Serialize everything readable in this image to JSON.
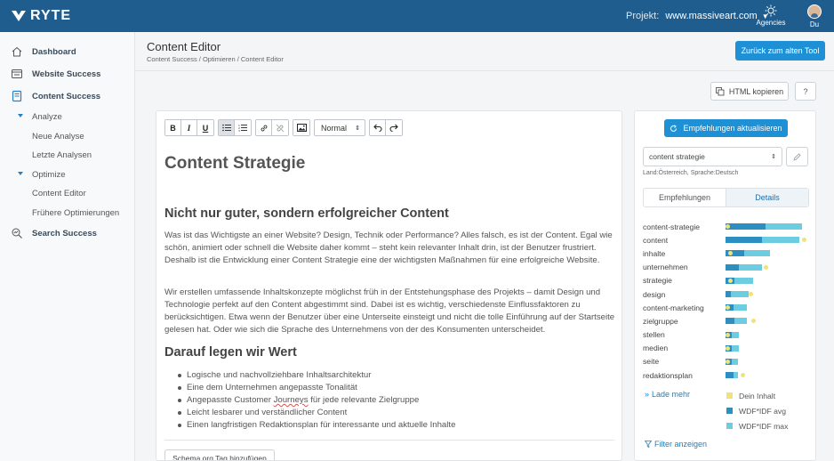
{
  "brand": {
    "name": "RYTE"
  },
  "topbar": {
    "project_label": "Projekt:",
    "project_value": "www.massiveart.com",
    "agencies_label": "Agencies",
    "user_label": "Du"
  },
  "sidebar": {
    "items": [
      {
        "label": "Dashboard",
        "icon": "home-icon"
      },
      {
        "label": "Website Success",
        "icon": "browser-icon"
      },
      {
        "label": "Content Success",
        "icon": "document-icon"
      },
      {
        "label": "Analyze"
      },
      {
        "label": "Neue Analyse"
      },
      {
        "label": "Letzte Analysen"
      },
      {
        "label": "Optimize"
      },
      {
        "label": "Content Editor"
      },
      {
        "label": "Frühere Optimierungen"
      },
      {
        "label": "Search Success",
        "icon": "search-chart-icon"
      }
    ]
  },
  "header": {
    "title": "Content Editor",
    "breadcrumb": "Content Success / Optimieren / Content Editor",
    "old_tool_button": "Zurück zum alten Tool",
    "html_copy_button": "HTML kopieren",
    "help_button": "?"
  },
  "editor": {
    "toolbar": {
      "bold": "B",
      "italic": "I",
      "underline": "U",
      "format_select": "Normal"
    },
    "h1": "Content Strategie",
    "h2_first": "Nicht nur guter, sondern erfolgreicher Content",
    "p1": "Was ist das Wichtigste an einer Website? Design, Technik oder Performance? Alles falsch, es ist der Content. Egal wie schön, animiert oder schnell die Website daher kommt – steht kein relevanter Inhalt drin, ist der Benutzer frustriert. Deshalb ist die Entwicklung einer Content Strategie eine der wichtigsten Maßnahmen für eine erfolgreiche Website.",
    "p2": "Wir erstellen umfassende Inhaltskonzepte möglichst früh in der Entstehungsphase des Projekts – damit Design und Technologie perfekt auf den Content abgestimmt sind. Dabei ist es wichtig, verschiedenste Einflussfaktoren zu berücksichtigen. Etwa wenn der Benutzer über eine Unterseite einsteigt und nicht die tolle Einführung auf der Startseite gelesen hat. Oder wie sich die Sprache des Unternehmens von der des Konsumenten unterscheidet.",
    "h2_second": "Darauf legen wir Wert",
    "bullets": [
      "Logische und nachvollziehbare Inhaltsarchitektur",
      "Eine dem Unternehmen angepasste Tonalität",
      "Angepasste Customer ",
      "Journeys",
      " für jede relevante Zielgruppe",
      "Leicht lesbarer und verständlicher Content",
      "Einen langfristigen Redaktionsplan für interessante und aktuelle Inhalte"
    ],
    "schema_button": "Schema.org Tag hinzufügen"
  },
  "panel": {
    "refresh_button": "Empfehlungen aktualisieren",
    "keyword_value": "content strategie",
    "land_info": "Land:Österreich, Sprache:Deutsch",
    "tabs": [
      "Empfehlungen",
      "Details"
    ],
    "load_more": "Lade mehr",
    "filter": "Filter anzeigen",
    "legend": [
      {
        "label": "Dein Inhalt",
        "color": "#eee37a"
      },
      {
        "label": "WDF*IDF avg",
        "color": "#2d8fc1"
      },
      {
        "label": "WDF*IDF max",
        "color": "#6dcde0"
      }
    ],
    "keywords": [
      {
        "term": "content-strategie",
        "avg": 0.52,
        "max": 1.0,
        "own": 0.0
      },
      {
        "term": "content",
        "avg": 0.48,
        "max": 0.96,
        "own": 1.0
      },
      {
        "term": "inhalte",
        "avg": 0.24,
        "max": 0.58,
        "own": 0.04
      },
      {
        "term": "unternehmen",
        "avg": 0.18,
        "max": 0.48,
        "own": 0.5
      },
      {
        "term": "strategie",
        "avg": 0.12,
        "max": 0.36,
        "own": 0.04
      },
      {
        "term": "design",
        "avg": 0.07,
        "max": 0.3,
        "own": 0.3
      },
      {
        "term": "content-marketing",
        "avg": 0.1,
        "max": 0.28,
        "own": 0.0
      },
      {
        "term": "zielgruppe",
        "avg": 0.12,
        "max": 0.28,
        "own": 0.34
      },
      {
        "term": "stellen",
        "avg": 0.08,
        "max": 0.18,
        "own": 0.0
      },
      {
        "term": "medien",
        "avg": 0.08,
        "max": 0.18,
        "own": 0.0
      },
      {
        "term": "seite",
        "avg": 0.08,
        "max": 0.16,
        "own": 0.0
      },
      {
        "term": "redaktionsplan",
        "avg": 0.1,
        "max": 0.16,
        "own": 0.2
      }
    ]
  }
}
